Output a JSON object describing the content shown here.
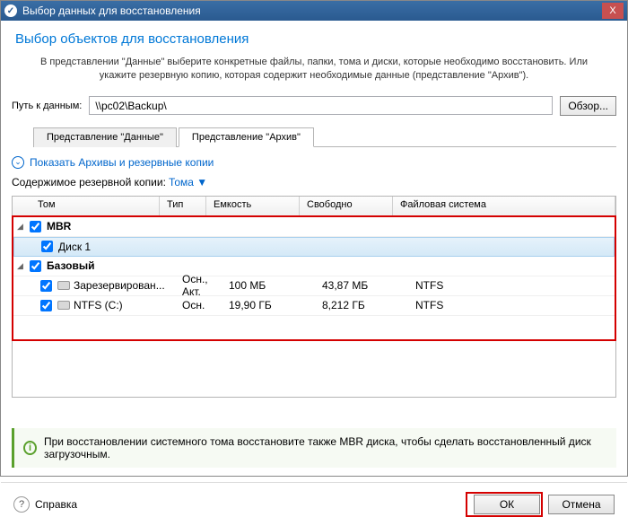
{
  "titlebar": {
    "text": "Выбор данных для восстановления",
    "close": "X"
  },
  "heading": "Выбор объектов для восстановления",
  "instruction": "В представлении \"Данные\" выберите конкретные файлы, папки, тома и диски, которые необходимо восстановить. Или укажите резервную копию, которая содержит необходимые данные (представление \"Архив\").",
  "path": {
    "label": "Путь к данным:",
    "value": "\\\\pc02\\Backup\\",
    "browse": "Обзор..."
  },
  "tabs": {
    "data": "Представление \"Данные\"",
    "archive": "Представление \"Архив\""
  },
  "showArchives": "Показать Архивы и резервные копии",
  "contents": {
    "label": "Содержимое резервной копии:",
    "link": "Тома ▼"
  },
  "columns": {
    "vol": "Том",
    "type": "Тип",
    "cap": "Емкость",
    "free": "Свободно",
    "fs": "Файловая система"
  },
  "rows": {
    "mbr": "MBR",
    "disk1": "Диск 1",
    "basic": "Базовый",
    "r1": {
      "name": "Зарезервирован...",
      "type": "Осн., Акт.",
      "cap": "100 МБ",
      "free": "43,87 МБ",
      "fs": "NTFS"
    },
    "r2": {
      "name": "NTFS (C:)",
      "type": "Осн.",
      "cap": "19,90 ГБ",
      "free": "8,212 ГБ",
      "fs": "NTFS"
    }
  },
  "info": "При восстановлении системного тома восстановите также MBR диска, чтобы сделать восстановленный диск загрузочным.",
  "footer": {
    "help": "Справка",
    "ok": "ОК",
    "cancel": "Отмена"
  }
}
